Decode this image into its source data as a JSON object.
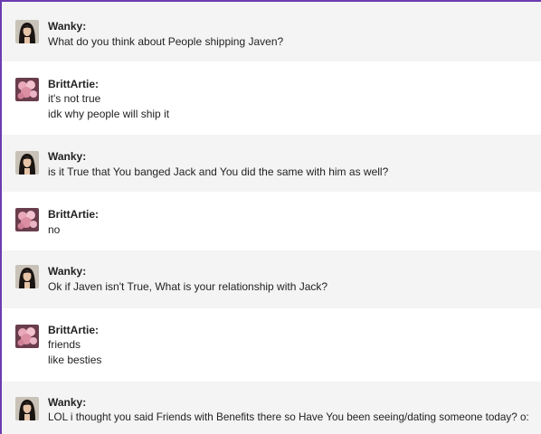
{
  "messages": [
    {
      "author": "Wanky:",
      "avatar": "woman-portrait-avatar",
      "lines": [
        "What do you think about People shipping Javen?"
      ]
    },
    {
      "author": "BrittArtie:",
      "avatar": "pink-floral-avatar",
      "lines": [
        "it's not true",
        "idk why people will ship it"
      ]
    },
    {
      "author": "Wanky:",
      "avatar": "woman-portrait-avatar",
      "lines": [
        "is it True that You banged Jack and You did the same with him as well?"
      ]
    },
    {
      "author": "BrittArtie:",
      "avatar": "pink-floral-avatar",
      "lines": [
        "no"
      ]
    },
    {
      "author": "Wanky:",
      "avatar": "woman-portrait-avatar",
      "lines": [
        "Ok if Javen isn't True, What is your relationship with Jack?"
      ]
    },
    {
      "author": "BrittArtie:",
      "avatar": "pink-floral-avatar",
      "lines": [
        "friends",
        "like besties"
      ]
    },
    {
      "author": "Wanky:",
      "avatar": "woman-portrait-avatar",
      "lines": [
        "LOL i thought you said Friends with Benefits there so Have You been seeing/dating someone today? o:"
      ]
    }
  ],
  "colors": {
    "accent": "#6c3bb0",
    "alt_row": "#f4f4f4",
    "text": "#222222"
  }
}
